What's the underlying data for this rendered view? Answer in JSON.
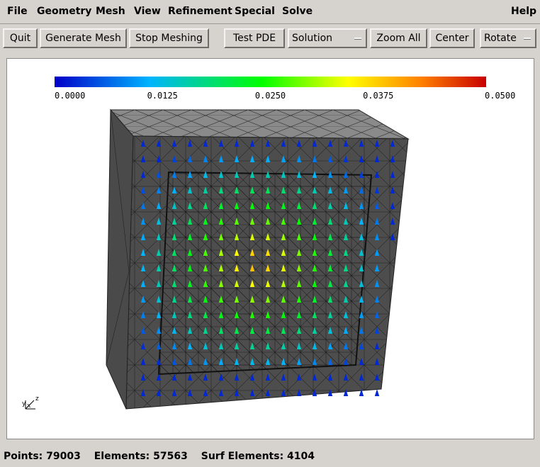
{
  "menu": {
    "file": "File",
    "geometry": "Geometry",
    "mesh": "Mesh",
    "view": "View",
    "refinement": "Refinement",
    "special": "Special",
    "solve": "Solve",
    "help": "Help"
  },
  "toolbar": {
    "quit": "Quit",
    "generate_mesh": "Generate Mesh",
    "stop_meshing": "Stop Meshing",
    "test_pde": "Test PDE",
    "solution_select": "Solution",
    "zoom_all": "Zoom All",
    "center": "Center",
    "rotate_select": "Rotate"
  },
  "colorbar": {
    "ticks": [
      "0.0000",
      "0.0125",
      "0.0250",
      "0.0375",
      "0.0500"
    ],
    "colors": [
      "#0000c8",
      "#00b4ff",
      "#00ff00",
      "#ffff00",
      "#ff8000",
      "#c80000"
    ]
  },
  "axes": {
    "x": "x",
    "y": "y",
    "z": "z"
  },
  "status": {
    "points": "Points: 79003",
    "elements": "Elements: 57563",
    "surf_elements": "Surf Elements: 4104"
  }
}
